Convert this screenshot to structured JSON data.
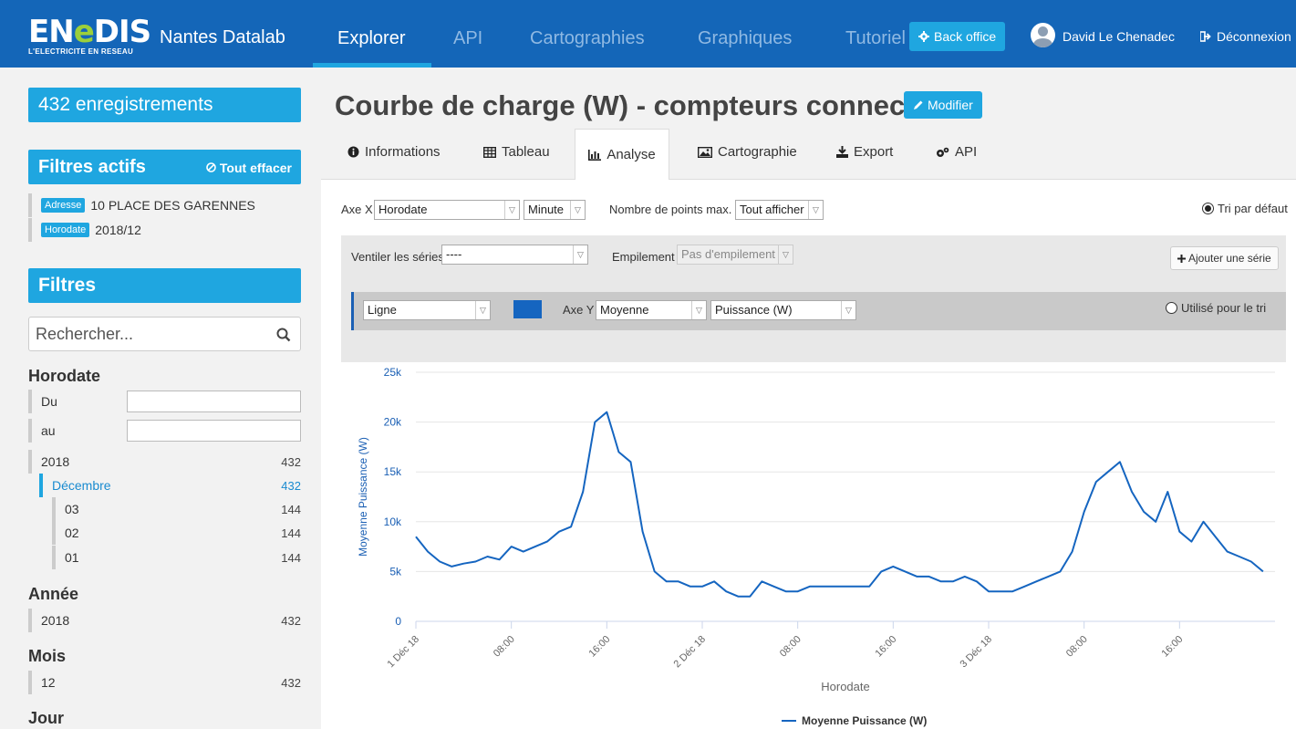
{
  "header": {
    "logo_text_left": "EN",
    "logo_text_green": "e",
    "logo_text_right": "DIS",
    "logo_subtitle": "L'ELECTRICITE EN RESEAU",
    "site_name": "Nantes Datalab",
    "nav": [
      "Explorer",
      "API",
      "Cartographies",
      "Graphiques",
      "Tutoriel"
    ],
    "active_nav": "Explorer",
    "back_office": "Back office",
    "user_name": "David Le Chenadec",
    "logout": "Déconnexion",
    "colors": {
      "bar": "#1466b8",
      "accent": "#1fa6e0",
      "logo_green": "#9ccf3b"
    }
  },
  "sidebar": {
    "records": "432 enregistrements",
    "active_filters_title": "Filtres actifs",
    "clear_all": "Tout effacer",
    "active_filters": [
      {
        "tag": "Adresse",
        "value": "10 PLACE DES GARENNES"
      },
      {
        "tag": "Horodate",
        "value": "2018/12"
      }
    ],
    "filters_title": "Filtres",
    "search_placeholder": "Rechercher...",
    "horodate": {
      "title": "Horodate",
      "from_label": "Du",
      "to_label": "au",
      "facets": [
        {
          "label": "2018",
          "count": "432"
        },
        {
          "label": "Décembre",
          "count": "432"
        },
        {
          "label": "03",
          "count": "144"
        },
        {
          "label": "02",
          "count": "144"
        },
        {
          "label": "01",
          "count": "144"
        }
      ]
    },
    "annee": {
      "title": "Année",
      "facets": [
        {
          "label": "2018",
          "count": "432"
        }
      ]
    },
    "mois": {
      "title": "Mois",
      "facets": [
        {
          "label": "12",
          "count": "432"
        }
      ]
    },
    "jour": {
      "title": "Jour"
    }
  },
  "main": {
    "title": "Courbe de charge (W) - compteurs connectés",
    "modify": "Modifier",
    "tabs": [
      "Informations",
      "Tableau",
      "Analyse",
      "Cartographie",
      "Export",
      "API"
    ],
    "active_tab": "Analyse",
    "controls": {
      "axis_x_label": "Axe X",
      "axis_x_value": "Horodate",
      "granularity": "Minute",
      "max_points_label": "Nombre de points max.",
      "max_points_value": "Tout afficher",
      "default_sort": "Tri par défaut",
      "split_series_label": "Ventiler les séries",
      "split_series_value": "----",
      "stacking_label": "Empilement",
      "stacking_value": "Pas d'empilement",
      "add_series": "Ajouter une série",
      "series_type": "Ligne",
      "series_color": "#1565c0",
      "axis_y_label": "Axe Y",
      "axis_y_agg": "Moyenne",
      "axis_y_field": "Puissance (W)",
      "used_for_sort": "Utilisé pour le tri"
    }
  },
  "chart_data": {
    "type": "line",
    "ylabel": "Moyenne Puissance (W)",
    "xlabel": "Horodate",
    "ylim": [
      0,
      25000
    ],
    "y_ticks": [
      "0",
      "5k",
      "10k",
      "15k",
      "20k",
      "25k"
    ],
    "x_ticks": [
      "1 Déc 18",
      "08:00",
      "16:00",
      "2 Déc 18",
      "08:00",
      "16:00",
      "3 Déc 18",
      "08:00",
      "16:00"
    ],
    "x_unit": "hours since 1 Déc 18 00:00",
    "grid": true,
    "legend_position": "bottom",
    "series": [
      {
        "name": "Moyenne Puissance (W)",
        "color": "#1565c0",
        "x": [
          0,
          1,
          2,
          3,
          4,
          5,
          6,
          7,
          8,
          9,
          10,
          11,
          12,
          13,
          14,
          15,
          16,
          16.5,
          17,
          18,
          19,
          20,
          21,
          22,
          23,
          24,
          25,
          26,
          27,
          28,
          29,
          30,
          31,
          32,
          33,
          34,
          35,
          36,
          37,
          38,
          39,
          40,
          41,
          42,
          43,
          44,
          45,
          46,
          47,
          48,
          49,
          50,
          51,
          52,
          53,
          54,
          55,
          56,
          57,
          58,
          59,
          60,
          61,
          62,
          63,
          64,
          65,
          66,
          67,
          68,
          69,
          70,
          71
        ],
        "values": [
          8500,
          7000,
          6000,
          5500,
          5800,
          6000,
          6500,
          6200,
          7500,
          7000,
          7500,
          8000,
          9000,
          9500,
          13000,
          20000,
          21000,
          19000,
          17000,
          16000,
          9000,
          5000,
          4000,
          4000,
          3500,
          3500,
          4000,
          3000,
          2500,
          2500,
          4000,
          3500,
          3000,
          3000,
          3500,
          3500,
          3500,
          3500,
          3500,
          3500,
          5000,
          5500,
          5000,
          4500,
          4500,
          4000,
          4000,
          4500,
          4000,
          3000,
          3000,
          3000,
          3500,
          4000,
          4500,
          5000,
          7000,
          11000,
          14000,
          15000,
          16000,
          13000,
          11000,
          10000,
          13000,
          9000,
          8000,
          10000,
          8500,
          7000,
          6500,
          6000,
          5000
        ]
      }
    ]
  }
}
